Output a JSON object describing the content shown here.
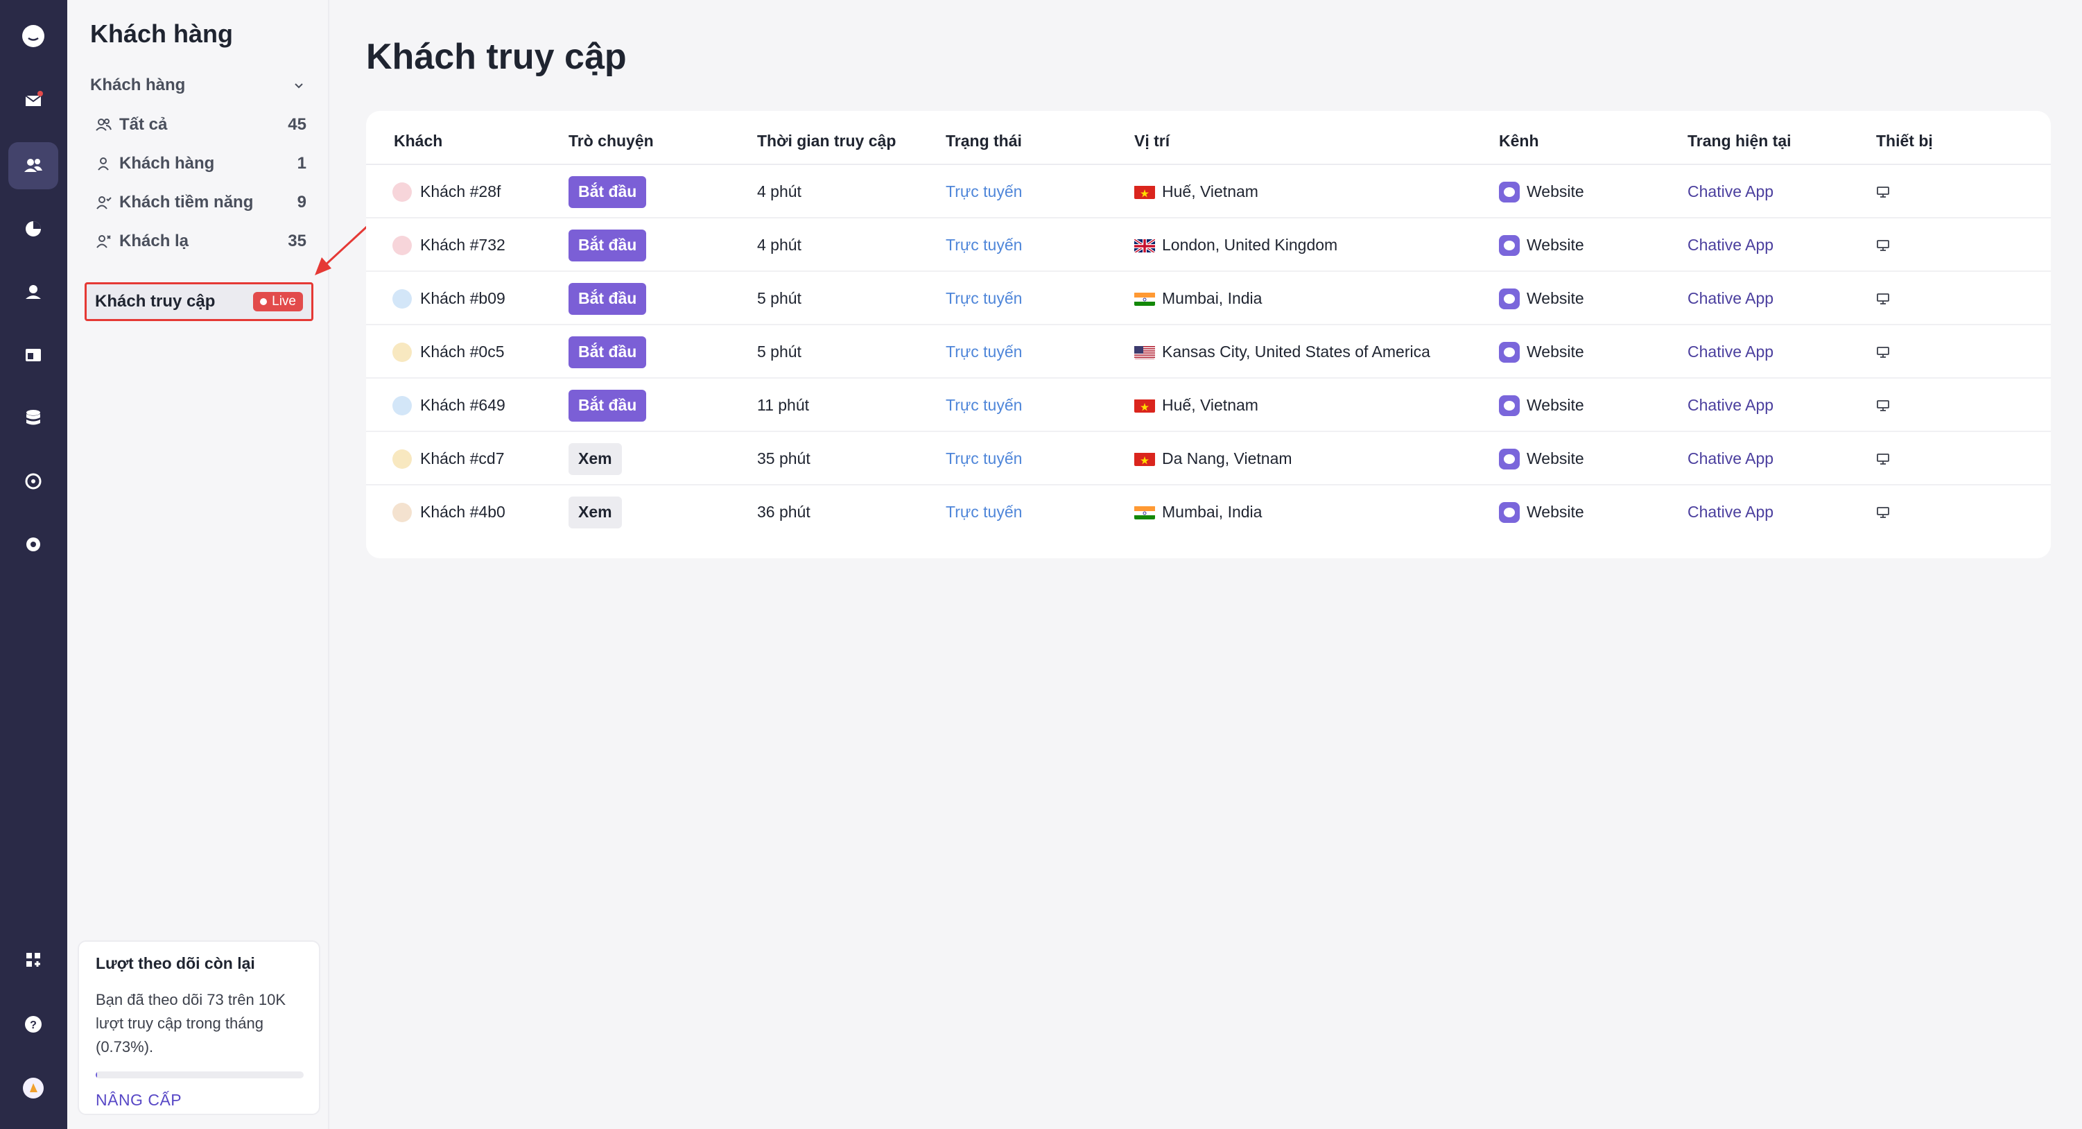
{
  "sidebar": {
    "title": "Khách hàng",
    "group_label": "Khách hàng",
    "items": [
      {
        "label": "Tất cả",
        "count": "45",
        "icon": "users-icon"
      },
      {
        "label": "Khách hàng",
        "count": "1",
        "icon": "user-icon"
      },
      {
        "label": "Khách tiềm năng",
        "count": "9",
        "icon": "user-check-icon"
      },
      {
        "label": "Khách lạ",
        "count": "35",
        "icon": "user-unknown-icon"
      }
    ],
    "active_item": {
      "label": "Khách truy cập",
      "badge": "Live"
    },
    "quota": {
      "title": "Lượt theo dõi còn lại",
      "description": "Bạn đã theo dõi 73 trên 10K lượt truy cập trong tháng (0.73%).",
      "progress_percent": 0.73,
      "upgrade_label": "NÂNG CẤP"
    }
  },
  "main": {
    "title": "Khách truy cập",
    "columns": [
      "Khách",
      "Trò chuyện",
      "Thời gian truy cập",
      "Trạng thái",
      "Vị trí",
      "Kênh",
      "Trang hiện tại",
      "Thiết bị"
    ],
    "rows": [
      {
        "visitor": "Khách #28f",
        "action": "Bắt đầu",
        "action_type": "start",
        "time": "4 phút",
        "status": "Trực tuyến",
        "flag": "vn",
        "location": "Huế, Vietnam",
        "channel": "Website",
        "page": "Chative App",
        "device": "desktop-icon",
        "avatar_color": "#f7d5da"
      },
      {
        "visitor": "Khách #732",
        "action": "Bắt đầu",
        "action_type": "start",
        "time": "4 phút",
        "status": "Trực tuyến",
        "flag": "gb",
        "location": "London, United Kingdom",
        "channel": "Website",
        "page": "Chative App",
        "device": "desktop-icon",
        "avatar_color": "#f7d5da"
      },
      {
        "visitor": "Khách #b09",
        "action": "Bắt đầu",
        "action_type": "start",
        "time": "5 phút",
        "status": "Trực tuyến",
        "flag": "in",
        "location": "Mumbai, India",
        "channel": "Website",
        "page": "Chative App",
        "device": "desktop-icon",
        "avatar_color": "#d3e6f8"
      },
      {
        "visitor": "Khách #0c5",
        "action": "Bắt đầu",
        "action_type": "start",
        "time": "5 phút",
        "status": "Trực tuyến",
        "flag": "us",
        "location": "Kansas City, United States of America",
        "channel": "Website",
        "page": "Chative App",
        "device": "desktop-icon",
        "avatar_color": "#f8e8c0"
      },
      {
        "visitor": "Khách #649",
        "action": "Bắt đầu",
        "action_type": "start",
        "time": "11 phút",
        "status": "Trực tuyến",
        "flag": "vn",
        "location": "Huế, Vietnam",
        "channel": "Website",
        "page": "Chative App",
        "device": "desktop-icon",
        "avatar_color": "#d3e6f8"
      },
      {
        "visitor": "Khách #cd7",
        "action": "Xem",
        "action_type": "view",
        "time": "35 phút",
        "status": "Trực tuyến",
        "flag": "vn",
        "location": "Da Nang, Vietnam",
        "channel": "Website",
        "page": "Chative App",
        "device": "desktop-icon",
        "avatar_color": "#f8e8c0"
      },
      {
        "visitor": "Khách #4b0",
        "action": "Xem",
        "action_type": "view",
        "time": "36 phút",
        "status": "Trực tuyến",
        "flag": "in",
        "location": "Mumbai, India",
        "channel": "Website",
        "page": "Chative App",
        "device": "desktop-icon",
        "avatar_color": "#f4e2cf"
      }
    ]
  },
  "colors": {
    "rail": "#2a2a47",
    "accent": "#7b5fd6",
    "status": "#4f86d9",
    "live": "#e24b4b"
  }
}
